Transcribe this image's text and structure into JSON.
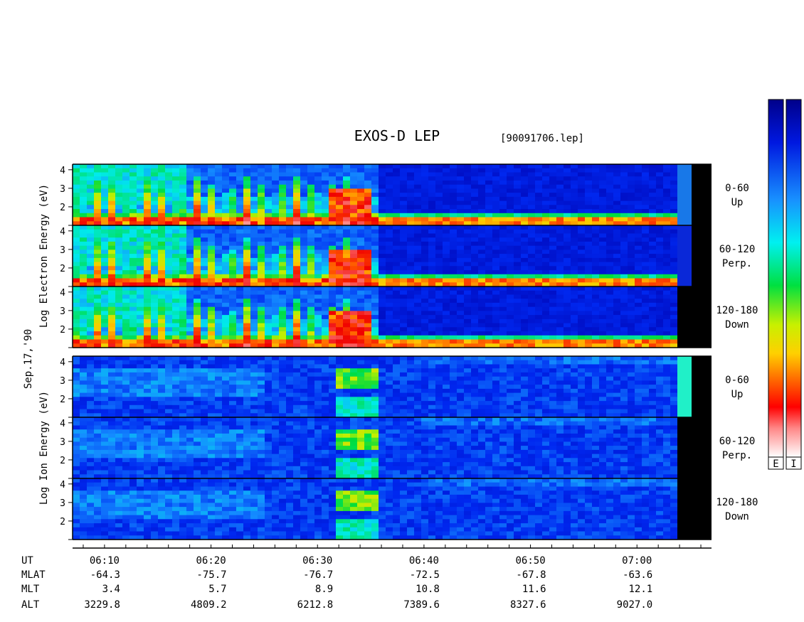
{
  "title": "EXOS-D LEP",
  "file_label": "[90091706.lep]",
  "date_label": "Sep.17,'90",
  "chart_data": {
    "type": "heatmap",
    "x": {
      "label": "UT",
      "ticks": [
        "06:10",
        "06:20",
        "06:30",
        "06:40",
        "06:50",
        "07:00"
      ],
      "range": [
        "06:07",
        "07:07"
      ]
    },
    "y_range": [
      1,
      4.3
    ],
    "y_ticks": [
      "1",
      "2",
      "3",
      "4"
    ],
    "groups": [
      {
        "ylabel": [
          "Log",
          "Electron",
          "Energy",
          "(eV)"
        ],
        "panels": [
          {
            "label_1": "0-60",
            "label_2": "Up",
            "kind": "electron",
            "bar_color": "#1878e8"
          },
          {
            "label_1": "60-120",
            "label_2": "Perp.",
            "kind": "electron",
            "bar_color": "#0a28d8"
          },
          {
            "label_1": "120-180",
            "label_2": "Down",
            "kind": "electron",
            "bar_color": "#000000"
          }
        ]
      },
      {
        "ylabel": [
          "Log",
          "Ion",
          "Energy",
          "(eV)"
        ],
        "panels": [
          {
            "label_1": "0-60",
            "label_2": "Up",
            "kind": "ion",
            "bar_color": "#20f0c8"
          },
          {
            "label_1": "60-120",
            "label_2": "Perp.",
            "kind": "ion",
            "bar_color": "#000000"
          },
          {
            "label_1": "120-180",
            "label_2": "Down",
            "kind": "ion",
            "bar_color": "#000000"
          }
        ]
      }
    ],
    "orbit_table": {
      "row_labels": [
        "UT",
        "MLAT",
        "MLT",
        "ALT"
      ],
      "columns": [
        {
          "mlat": "-64.3",
          "mlt": "3.4",
          "alt": "3229.8"
        },
        {
          "mlat": "-75.7",
          "mlt": "5.7",
          "alt": "4809.2"
        },
        {
          "mlat": "-76.7",
          "mlt": "8.9",
          "alt": "6212.8"
        },
        {
          "mlat": "-72.5",
          "mlt": "10.8",
          "alt": "7389.6"
        },
        {
          "mlat": "-67.8",
          "mlt": "11.6",
          "alt": "8327.6"
        },
        {
          "mlat": "-63.6",
          "mlt": "12.1",
          "alt": "9027.0"
        }
      ]
    },
    "colorbar": {
      "labels": [
        "E",
        "I"
      ]
    }
  }
}
